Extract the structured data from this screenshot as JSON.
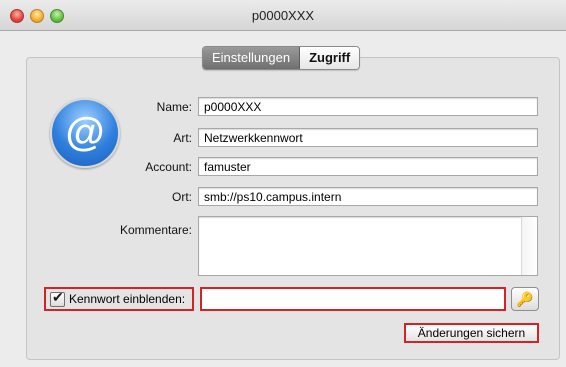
{
  "window": {
    "title": "p0000XXX"
  },
  "tabs": [
    {
      "label": "Einstellungen",
      "active": true
    },
    {
      "label": "Zugriff",
      "active": false
    }
  ],
  "form": {
    "name": {
      "label": "Name:",
      "value": "p0000XXX"
    },
    "art": {
      "label": "Art:",
      "value": "Netzwerkkennwort"
    },
    "account": {
      "label": "Account:",
      "value": "famuster"
    },
    "ort": {
      "label": "Ort:",
      "value": "smb://ps10.campus.intern"
    },
    "kommentare": {
      "label": "Kommentare:",
      "value": ""
    },
    "show_password": {
      "label": "Kennwort einblenden:",
      "checked": true
    },
    "password": {
      "value": ""
    }
  },
  "buttons": {
    "save": "Änderungen sichern",
    "key_icon": "key-icon"
  },
  "icons": {
    "account": "at-icon"
  }
}
